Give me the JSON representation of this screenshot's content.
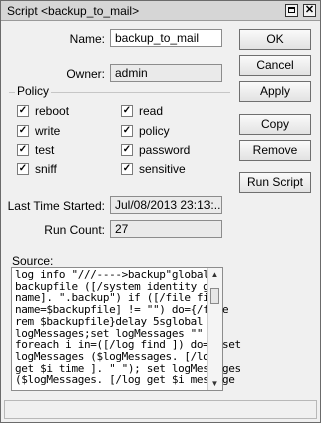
{
  "window": {
    "title": "Script <backup_to_mail>"
  },
  "fields": {
    "name_label": "Name:",
    "name_value": "backup_to_mail",
    "owner_label": "Owner:",
    "owner_value": "admin",
    "last_started_label": "Last Time Started:",
    "last_started_value": "Jul/08/2013 23:13:...",
    "run_count_label": "Run Count:",
    "run_count_value": "27"
  },
  "policy": {
    "title": "Policy",
    "items": [
      {
        "label": "reboot",
        "checked": true
      },
      {
        "label": "read",
        "checked": true
      },
      {
        "label": "write",
        "checked": true
      },
      {
        "label": "policy",
        "checked": true
      },
      {
        "label": "test",
        "checked": true
      },
      {
        "label": "password",
        "checked": true
      },
      {
        "label": "sniff",
        "checked": true
      },
      {
        "label": "sensitive",
        "checked": true
      }
    ]
  },
  "buttons": {
    "ok": "OK",
    "cancel": "Cancel",
    "apply": "Apply",
    "copy": "Copy",
    "remove": "Remove",
    "run_script": "Run Script"
  },
  "source": {
    "label": "Source:",
    "text": "log info \"///---->backup\"global\nbackupfile ([/system identity get\nname]. \".backup\") if ([/file find\nname=$backupfile] != \"\") do={/file\nrem $backupfile}delay 5sglobal\nlogMessages;set logMessages \"\"\nforeach i in=([/log find ]) do={ set\nlogMessages ($logMessages. [/log\nget $i time ]. \" \"); set logMessages\n($logMessages. [/log get $i message"
  },
  "status_bar": {
    "text": ""
  }
}
